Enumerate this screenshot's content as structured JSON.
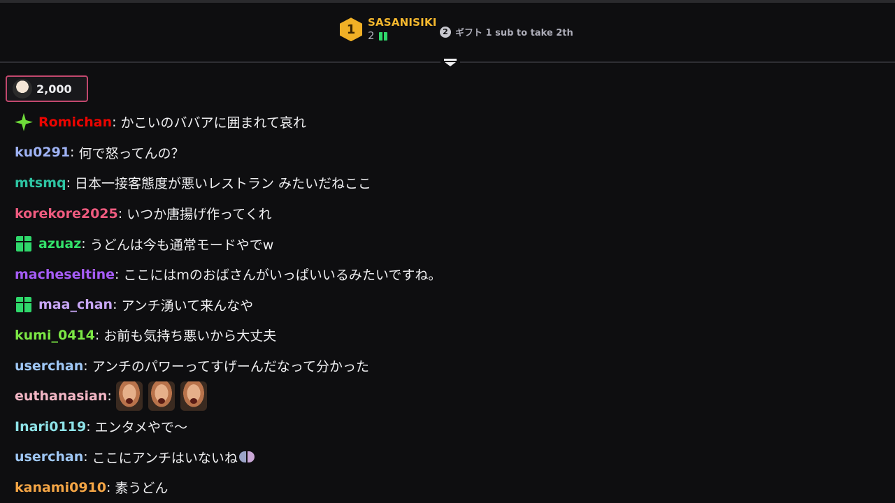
{
  "leaderboard": {
    "rank1": {
      "rank": "1",
      "name": "SASANISIKI",
      "count": "2"
    },
    "rank2": {
      "rank": "2",
      "text": "ギフト 1 sub to take 2th"
    }
  },
  "cheer": {
    "amount": "2,000"
  },
  "messages": [
    {
      "user": "Romichan",
      "color": "#eb0400",
      "badge": "sparkle-icon",
      "text": "かこいのババアに囲まれて哀れ"
    },
    {
      "user": "ku0291",
      "color": "#9fb3f5",
      "text": "何で怒ってんの？"
    },
    {
      "user": "mtsmq",
      "color": "#2ec4a3",
      "text": "日本一接客態度が悪いレストラン みたいだねここ"
    },
    {
      "user": "korekore2025",
      "color": "#ef5b7f",
      "text": "いつか唐揚げ作ってくれ"
    },
    {
      "user": "azuaz",
      "color": "#33e06a",
      "badge": "gift-icon",
      "text": "うどんは今も通常モードやでw"
    },
    {
      "user": "macheseltine",
      "color": "#a55cf6",
      "text": "ここにはmのおばさんがいっぱいいるみたいですね。"
    },
    {
      "user": "maa_chan",
      "color": "#c7a6f5",
      "badge": "gift-icon",
      "text": "アンチ湧いて来んなや"
    },
    {
      "user": "kumi_0414",
      "color": "#7ce845",
      "text": "お前も気持ち悪いから大丈夫"
    },
    {
      "user": "userchan",
      "color": "#9fc7f5",
      "text": "アンチのパワーってすげーんだなって分かった"
    },
    {
      "user": "euthanasian",
      "color": "#f3b6c5",
      "text": "",
      "emotes": [
        "laughing-face-emote",
        "laughing-face-emote",
        "laughing-face-emote"
      ]
    },
    {
      "user": "Inari0119",
      "color": "#8ee3e8",
      "text": "エンタメやで〜"
    },
    {
      "user": "userchan",
      "color": "#9fc7f5",
      "text": "ここにアンチはいないね"
    },
    {
      "user": "kanami0910",
      "color": "#f4a545",
      "text": "素うどん"
    }
  ]
}
